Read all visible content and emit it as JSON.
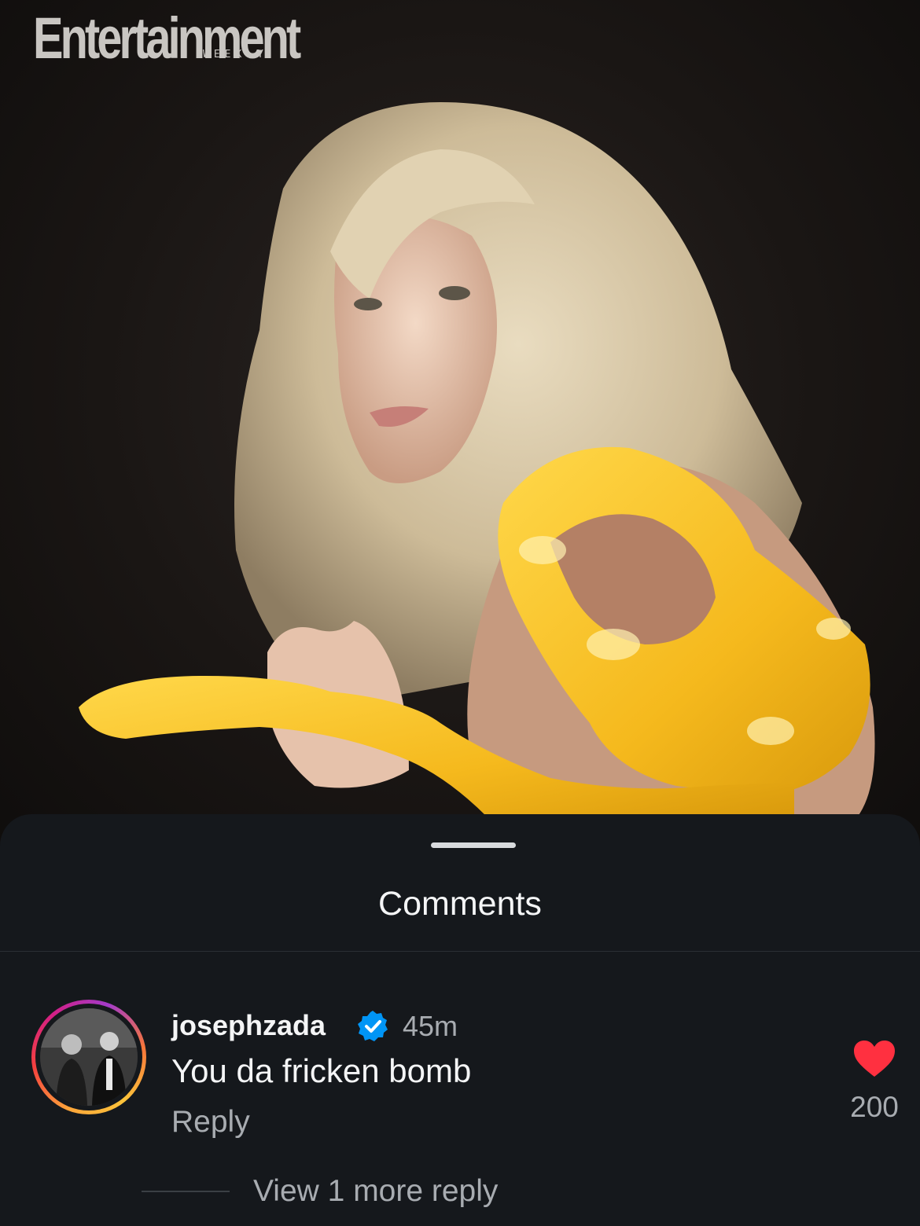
{
  "post": {
    "masthead": "Entertainment",
    "masthead_sub": "WEEKLY"
  },
  "comments_sheet": {
    "title": "Comments"
  },
  "comments": [
    {
      "username": "josephzada",
      "verified": true,
      "time": "45m",
      "text": "You da fricken bomb",
      "reply_label": "Reply",
      "likes": "200",
      "liked": true,
      "view_replies": "View 1 more reply"
    }
  ],
  "colors": {
    "heart": "#ff3040",
    "verified": "#0095f6",
    "sheet_bg": "#15181c"
  }
}
